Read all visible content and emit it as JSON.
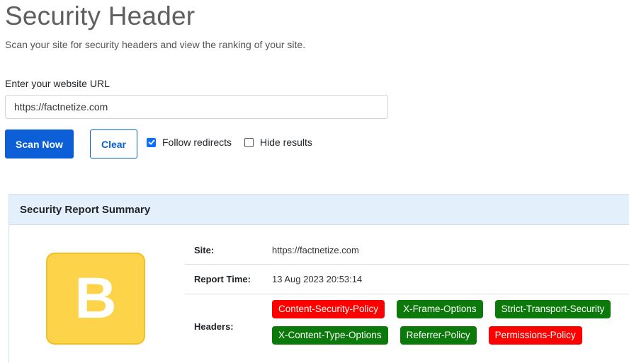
{
  "header": {
    "title": "Security Header",
    "subtitle": "Scan your site for security headers and view the ranking of your site."
  },
  "form": {
    "url_label": "Enter your website URL",
    "url_value": "https://factnetize.com",
    "scan_label": "Scan Now",
    "clear_label": "Clear",
    "follow_redirects_label": "Follow redirects",
    "follow_redirects_checked": true,
    "hide_results_label": "Hide results",
    "hide_results_checked": false
  },
  "report": {
    "title": "Security Report Summary",
    "grade": "B",
    "grade_color": "#fdd34a",
    "site_label": "Site:",
    "site_value": "https://factnetize.com",
    "time_label": "Report Time:",
    "time_value": "13 Aug 2023 20:53:14",
    "headers_label": "Headers:",
    "headers": [
      {
        "name": "Content-Security-Policy",
        "status": "missing",
        "color": "#ff0000"
      },
      {
        "name": "X-Frame-Options",
        "status": "present",
        "color": "#0b7a0b"
      },
      {
        "name": "Strict-Transport-Security",
        "status": "present",
        "color": "#0b7a0b"
      },
      {
        "name": "X-Content-Type-Options",
        "status": "present",
        "color": "#0b7a0b"
      },
      {
        "name": "Referrer-Policy",
        "status": "present",
        "color": "#0b7a0b"
      },
      {
        "name": "Permissions-Policy",
        "status": "missing",
        "color": "#ff0000"
      }
    ]
  },
  "colors": {
    "primary": "#0d5fd8",
    "card_header_bg": "#e3f0fc"
  }
}
